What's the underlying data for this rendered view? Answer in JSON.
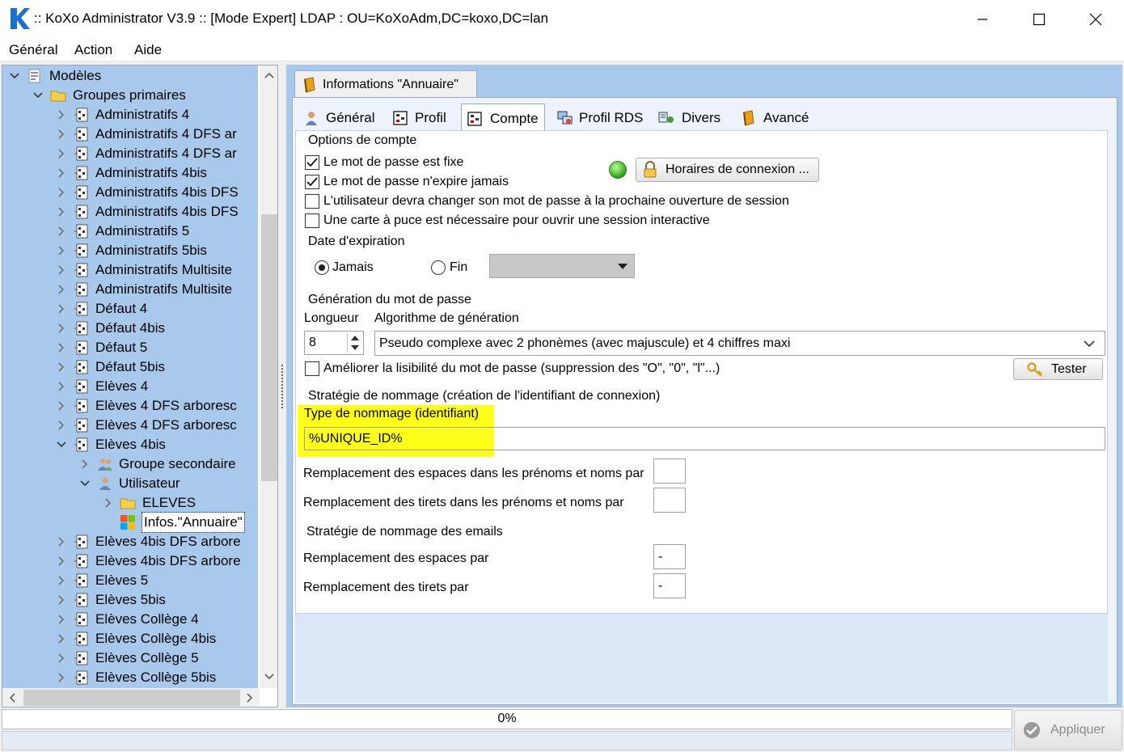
{
  "window": {
    "title": ":: KoXo Administrator V3.9 :: [Mode Expert] LDAP : OU=KoXoAdm,DC=koxo,DC=lan"
  },
  "menu": [
    "Général",
    "Action",
    "Aide"
  ],
  "tree": {
    "items": [
      {
        "level": 0,
        "exp": "open",
        "icon": "models-icon",
        "label": "Modèles"
      },
      {
        "level": 1,
        "exp": "open",
        "icon": "folder-icon",
        "label": "Groupes primaires"
      },
      {
        "level": 2,
        "exp": "closed",
        "icon": "template-icon",
        "label": "Administratifs 4"
      },
      {
        "level": 2,
        "exp": "closed",
        "icon": "template-icon",
        "label": "Administratifs 4 DFS ar"
      },
      {
        "level": 2,
        "exp": "closed",
        "icon": "template-icon",
        "label": "Administratifs 4 DFS ar"
      },
      {
        "level": 2,
        "exp": "closed",
        "icon": "template-icon",
        "label": "Administratifs 4bis"
      },
      {
        "level": 2,
        "exp": "closed",
        "icon": "template-icon",
        "label": "Administratifs 4bis DFS"
      },
      {
        "level": 2,
        "exp": "closed",
        "icon": "template-icon",
        "label": "Administratifs 4bis DFS"
      },
      {
        "level": 2,
        "exp": "closed",
        "icon": "template-icon",
        "label": "Administratifs 5"
      },
      {
        "level": 2,
        "exp": "closed",
        "icon": "template-icon",
        "label": "Administratifs 5bis"
      },
      {
        "level": 2,
        "exp": "closed",
        "icon": "template-icon",
        "label": "Administratifs Multisite"
      },
      {
        "level": 2,
        "exp": "closed",
        "icon": "template-icon",
        "label": "Administratifs Multisite"
      },
      {
        "level": 2,
        "exp": "closed",
        "icon": "template-icon",
        "label": "Défaut 4"
      },
      {
        "level": 2,
        "exp": "closed",
        "icon": "template-icon",
        "label": "Défaut 4bis"
      },
      {
        "level": 2,
        "exp": "closed",
        "icon": "template-icon",
        "label": "Défaut 5"
      },
      {
        "level": 2,
        "exp": "closed",
        "icon": "template-icon",
        "label": "Défaut 5bis"
      },
      {
        "level": 2,
        "exp": "closed",
        "icon": "template-icon",
        "label": "Elèves 4"
      },
      {
        "level": 2,
        "exp": "closed",
        "icon": "template-icon",
        "label": "Elèves 4 DFS arboresc"
      },
      {
        "level": 2,
        "exp": "closed",
        "icon": "template-icon",
        "label": "Elèves 4 DFS arboresc"
      },
      {
        "level": 2,
        "exp": "open",
        "icon": "template-icon",
        "label": "Elèves 4bis"
      },
      {
        "level": 3,
        "exp": "closed",
        "icon": "users-icon",
        "label": "Groupe secondaire"
      },
      {
        "level": 3,
        "exp": "open",
        "icon": "user-icon",
        "label": "Utilisateur"
      },
      {
        "level": 4,
        "exp": "closed",
        "icon": "folder-icon",
        "label": "ELEVES"
      },
      {
        "level": 4,
        "exp": "none",
        "icon": "windows-icon",
        "label": "Infos.\"Annuaire\"",
        "selected": true
      },
      {
        "level": 2,
        "exp": "closed",
        "icon": "template-icon",
        "label": "Elèves 4bis DFS arbore"
      },
      {
        "level": 2,
        "exp": "closed",
        "icon": "template-icon",
        "label": "Elèves 4bis DFS arbore"
      },
      {
        "level": 2,
        "exp": "closed",
        "icon": "template-icon",
        "label": "Elèves 5"
      },
      {
        "level": 2,
        "exp": "closed",
        "icon": "template-icon",
        "label": "Elèves 5bis"
      },
      {
        "level": 2,
        "exp": "closed",
        "icon": "template-icon",
        "label": "Elèves Collège 4"
      },
      {
        "level": 2,
        "exp": "closed",
        "icon": "template-icon",
        "label": "Elèves Collège 4bis"
      },
      {
        "level": 2,
        "exp": "closed",
        "icon": "template-icon",
        "label": "Elèves Collège 5"
      },
      {
        "level": 2,
        "exp": "closed",
        "icon": "template-icon",
        "label": "Elèves Collège 5bis"
      }
    ]
  },
  "outer_tab": {
    "label": "Informations \"Annuaire\""
  },
  "tabs": [
    {
      "label": "Général",
      "icon": "user-icon"
    },
    {
      "label": "Profil",
      "icon": "profile-icon"
    },
    {
      "label": "Compte",
      "icon": "profile-icon",
      "active": true
    },
    {
      "label": "Profil RDS",
      "icon": "rds-icon"
    },
    {
      "label": "Divers",
      "icon": "misc-icon"
    },
    {
      "label": "Avancé",
      "icon": "book-icon"
    }
  ],
  "account": {
    "options_title": "Options de compte",
    "options": [
      {
        "label": "Le mot de passe est fixe",
        "checked": true
      },
      {
        "label": "Le mot de passe n'expire jamais",
        "checked": true
      },
      {
        "label": "L'utilisateur devra changer son mot de passe à la prochaine ouverture de session",
        "checked": false
      },
      {
        "label": "Une carte à puce est nécessaire pour ouvrir une session interactive",
        "checked": false
      }
    ],
    "logon_hours_button": "Horaires de connexion ...",
    "status_color": "#2fbf1f",
    "expiration_title": "Date d'expiration",
    "expiration_never": "Jamais",
    "expiration_end": "Fin",
    "expiration_date": "",
    "password_gen_title": "Génération du mot de passe",
    "length_label": "Longueur",
    "length_value": "8",
    "algorithm_label": "Algorithme de génération",
    "algorithm_value": "Pseudo complexe avec 2 phonèmes (avec majuscule) et 4 chiffres maxi",
    "readability_label": "Améliorer la lisibilité du mot de passe (suppression des \"O\", \"0\", \"l\"...)",
    "test_button": "Tester",
    "naming_title": "Stratégie de nommage (création de l'identifiant de connexion)",
    "naming_type_label": "Type de nommage (identifiant)",
    "naming_type_value": "%UNIQUE_ID%",
    "replace_spaces_names_label": "Remplacement des espaces dans les prénoms et noms par",
    "replace_spaces_names_value": "",
    "replace_dashes_names_label": "Remplacement des tirets dans les prénoms et noms par",
    "replace_dashes_names_value": "",
    "email_title": "Stratégie de nommage des emails",
    "email_replace_spaces_label": "Remplacement des espaces  par",
    "email_replace_spaces_value": "-",
    "email_replace_dashes_label": "Remplacement des tirets par",
    "email_replace_dashes_value": "-"
  },
  "footer": {
    "progress_text": "0%",
    "progress": 0,
    "apply_button": "Appliquer"
  },
  "colors": {
    "tree_bg": "#a9c9ec",
    "highlight": "#ffff1a",
    "logo": "#1a6fd1"
  }
}
